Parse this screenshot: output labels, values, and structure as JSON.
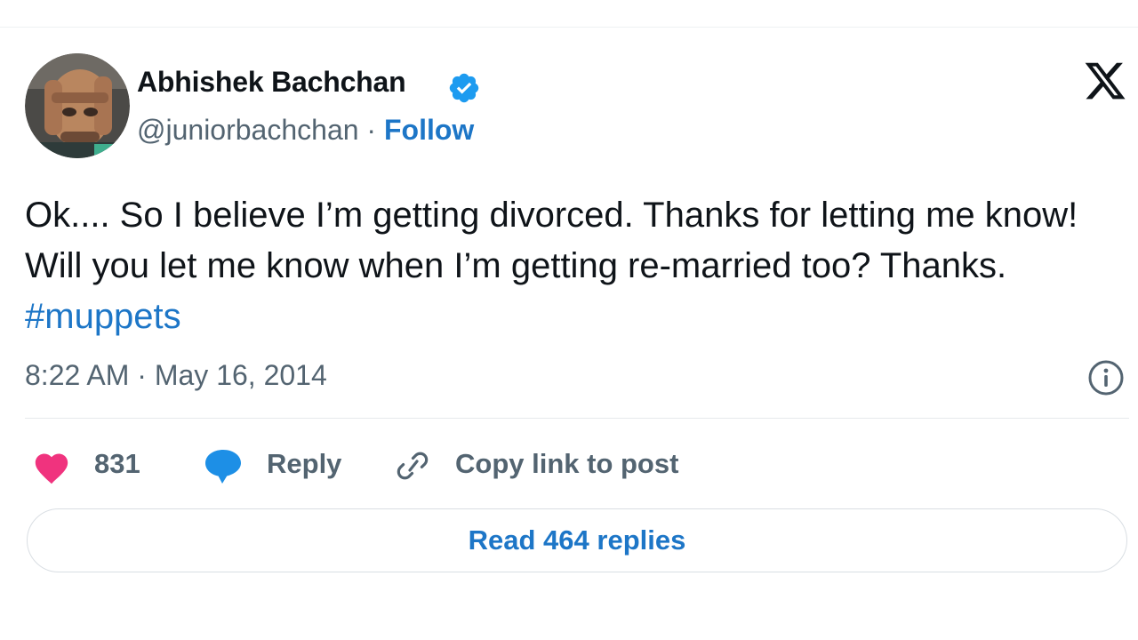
{
  "author": {
    "name": "Abhishek Bachchan",
    "handle": "@juniorbachchan",
    "separator": "·",
    "follow_label": "Follow",
    "verified": true
  },
  "tweet": {
    "text": "Ok.... So I believe I’m getting divorced. Thanks for letting me know! Will you let me know when I’m getting re-married too? Thanks. ",
    "hashtag": "#muppets",
    "timestamp": "8:22 AM · May 16, 2014"
  },
  "actions": {
    "like_count": "831",
    "reply_label": "Reply",
    "copy_link_label": "Copy link to post"
  },
  "read_replies_label": "Read 464 replies",
  "icons": {
    "verified": "verified-badge-icon",
    "brand": "x-logo-icon",
    "info": "info-icon",
    "like": "heart-icon",
    "reply": "speech-bubble-icon",
    "link": "link-icon"
  },
  "colors": {
    "accent": "#1d76c7",
    "like": "#f0337e",
    "reply": "#1d8fe6",
    "muted": "#536471",
    "text": "#0f1419"
  }
}
